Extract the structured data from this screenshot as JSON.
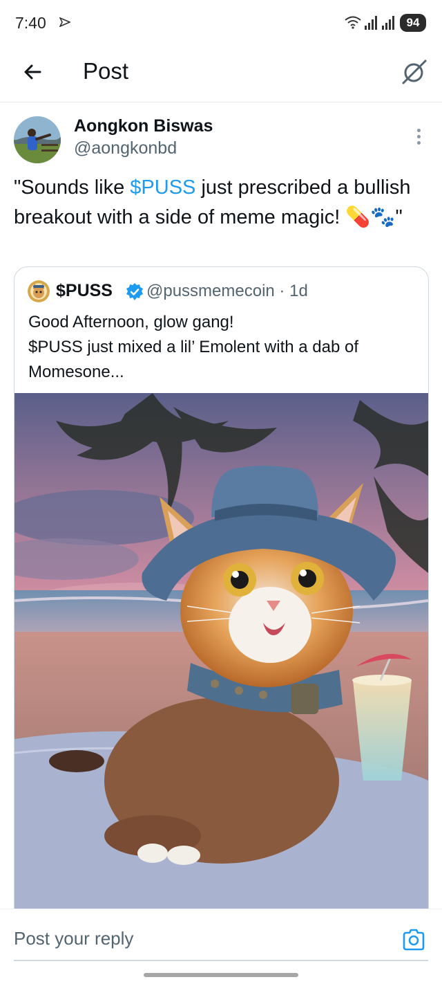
{
  "status_bar": {
    "time": "7:40",
    "battery": "94",
    "icons": [
      "navigation-arrow-icon",
      "wifi-icon",
      "signal-icon",
      "signal-icon",
      "battery-icon"
    ]
  },
  "header": {
    "title": "Post",
    "back_icon": "arrow-left-icon",
    "grok_icon": "grok-icon"
  },
  "post": {
    "author_name": "Aongkon Biswas",
    "author_handle": "@aongkonbd",
    "text_prefix": "\"Sounds like ",
    "cashtag": "$PUSS",
    "text_suffix": " just prescribed a bullish breakout with a side of meme magic! 💊🐾\""
  },
  "quote": {
    "name": "$PUSS",
    "verified": true,
    "handle_time": "@pussmemecoin · 1d",
    "text_lines": [
      "Good Afternoon, glow gang!",
      "$PUSS just mixed a lil’ Emolent with a dab of",
      "Momesone..."
    ]
  },
  "reply": {
    "placeholder": "Post your reply",
    "camera_icon": "camera-icon"
  },
  "colors": {
    "accent": "#1d9bf0",
    "secondary_text": "#536471",
    "border": "#cfd9de"
  }
}
